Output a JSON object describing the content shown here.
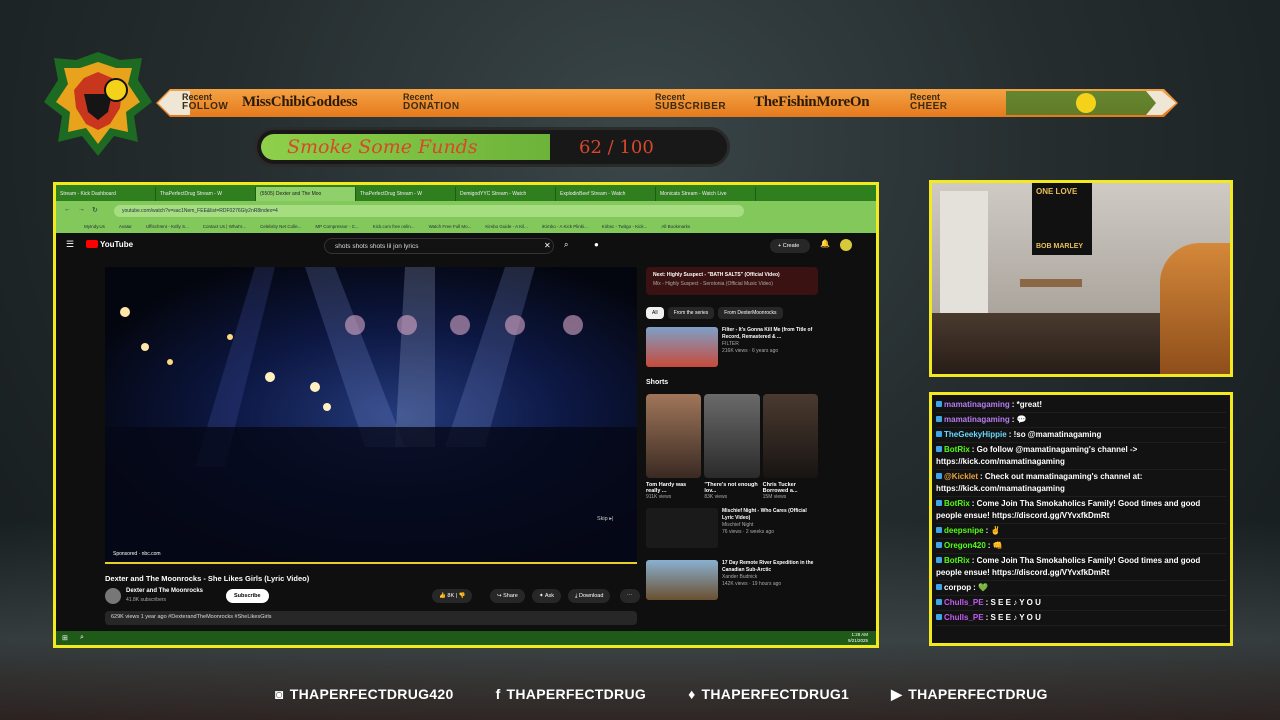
{
  "ticker": {
    "items": [
      {
        "prefix": "Recent",
        "kind": "FOLLOW",
        "name": "MissChibiGoddess"
      },
      {
        "prefix": "Recent",
        "kind": "DONATION",
        "name": ""
      },
      {
        "prefix": "Recent",
        "kind": "SUBSCRIBER",
        "name": "TheFishinMoreOn"
      },
      {
        "prefix": "Recent",
        "kind": "CHEER",
        "name": ""
      }
    ]
  },
  "goal": {
    "title": "Smoke Some Funds",
    "current": 62,
    "target": 100,
    "display": "62 / 100",
    "fraction": 0.62
  },
  "browser": {
    "tabs": [
      "Stream - Kick Dashboard",
      "ThaPerfectDrug Stream - W",
      "(5505) Dexter and The Moo",
      "ThaPerfectDrug Stream - W",
      "DemigodYYC Stream - Watch",
      "ExplodinBeef Stream - Watch",
      "Monicats Stream - Watch Live"
    ],
    "url": "youtube.com/watch?v=sac1Nem_FEE&list=RDF0276Gly2nR8index=4",
    "bookmarks": [
      "MyIndy.Us",
      "Avatar",
      "Uffisch!ent - Kelly S...",
      "Contact Us | What's...",
      "Celebrity Net Colle...",
      "MP Compressor - C...",
      "Kick.com free onlin...",
      "Watch Free Full Mo...",
      "Kimbo Guide - A Kil...",
      "iKimbo - A Kick Plinki...",
      "Kirbsc - Twitgo - Kick...",
      "All Bookmarks"
    ]
  },
  "youtube": {
    "logo": "YouTube",
    "search": "shots shots shots lil jon lyrics",
    "create": "Create",
    "video_title": "Dexter and The Moonrocks - She Likes Girls (Lyric Video)",
    "sponsored": "Sponsored · nbc.com",
    "skip": "Skip ▸|",
    "channel": "Dexter and The Moonrocks",
    "subscribers": "41.8K subscribers",
    "subscribe": "Subscribe",
    "likes": "8K",
    "share": "Share",
    "ask": "Ask",
    "download": "Download",
    "desc": "629K views  1 year ago  #DexterandTheMoonrocks #SheLikesGirls",
    "next_title": "Next: Highly Suspect - \"BATH SALTS\" (Official Video)",
    "next_sub": "Mix - Highly Suspect - Serotonia (Official Music Video)",
    "chips": [
      "All",
      "From the series",
      "From DexterMoonrocks"
    ],
    "related1": {
      "title": "Filter - It's Gonna Kill Me (from Title of Record, Remastered & ...",
      "channel": "FILTER",
      "meta": "216K views · 6 years ago",
      "duration": "5:05"
    },
    "shorts_label": "Shorts",
    "shorts": [
      {
        "title": "Tom Hardy was really ...",
        "views": "911K views"
      },
      {
        "title": "\"There's not enough lov...",
        "views": "83K views"
      },
      {
        "title": "Chris Tucker Borrowed a...",
        "views": "15M views"
      }
    ],
    "related2": {
      "title": "Mischief Night - Who Cares (Official Lyric Video)",
      "channel": "Mischief Night",
      "meta": "76 views · 2 weeks ago",
      "duration": "3:50"
    },
    "related3": {
      "title": "17 Day Remote River Expedition in the Canadian Sub-Arctic",
      "channel": "Xander Budnick",
      "meta": "142K views · 19 hours ago",
      "duration": "1:41:08"
    }
  },
  "taskbar": {
    "time": "1:28 AM",
    "date": "9/21/2025"
  },
  "webcam": {
    "poster_top": "ONE LOVE",
    "poster_bottom": "BOB MARLEY"
  },
  "chat": [
    {
      "user": "mamatinagaming",
      "color": "#b77cf2",
      "text": ": *great!"
    },
    {
      "user": "mamatinagaming",
      "color": "#b77cf2",
      "text": ": 💬"
    },
    {
      "user": "TheGeekyHippie",
      "color": "#6ad7ff",
      "text": ": !so @mamatinagaming"
    },
    {
      "user": "BotRix",
      "color": "#53fc18",
      "text": ": Go follow @mamatinagaming's channel -> https://kick.com/mamatinagaming"
    },
    {
      "user": "@Kicklet",
      "color": "#e8a33d",
      "text": ": Check out mamatinagaming's channel at: https://kick.com/mamatinagaming"
    },
    {
      "user": "BotRix",
      "color": "#53fc18",
      "text": ": Come Join Tha Smokaholics Family! Good times and good people ensue! https://discord.gg/VYvxfkDmRt"
    },
    {
      "user": "deepsnipe",
      "color": "#53fc18",
      "text": ": ✌"
    },
    {
      "user": "Oregon420",
      "color": "#53fc18",
      "text": ": 👊"
    },
    {
      "user": "BotRix",
      "color": "#53fc18",
      "text": ": Come Join Tha Smokaholics Family! Good times and good people ensue! https://discord.gg/VYvxfkDmRt"
    },
    {
      "user": "corpop",
      "color": "#ffffff",
      "text": ": 💚"
    },
    {
      "user": "Chulls_PE",
      "color": "#c25cf0",
      "text": ": S E E ♪ Y O U"
    },
    {
      "user": "Chulls_PE",
      "color": "#c25cf0",
      "text": ": S E E ♪ Y O U"
    }
  ],
  "social": [
    {
      "icon": "instagram-icon",
      "glyph": "◙",
      "handle": "THAPERFECTDRUG420"
    },
    {
      "icon": "facebook-icon",
      "glyph": "f",
      "handle": "THAPERFECTDRUG"
    },
    {
      "icon": "twitter-icon",
      "glyph": "♦",
      "handle": "THAPERFECTDRUG1"
    },
    {
      "icon": "youtube-icon",
      "glyph": "▶",
      "handle": "THAPERFECTDRUG"
    }
  ],
  "colors": {
    "frame": "#f2ea1e",
    "ticker": "#f08c28",
    "goal_fill": "#8ed04a",
    "goal_text": "#d6482a"
  }
}
